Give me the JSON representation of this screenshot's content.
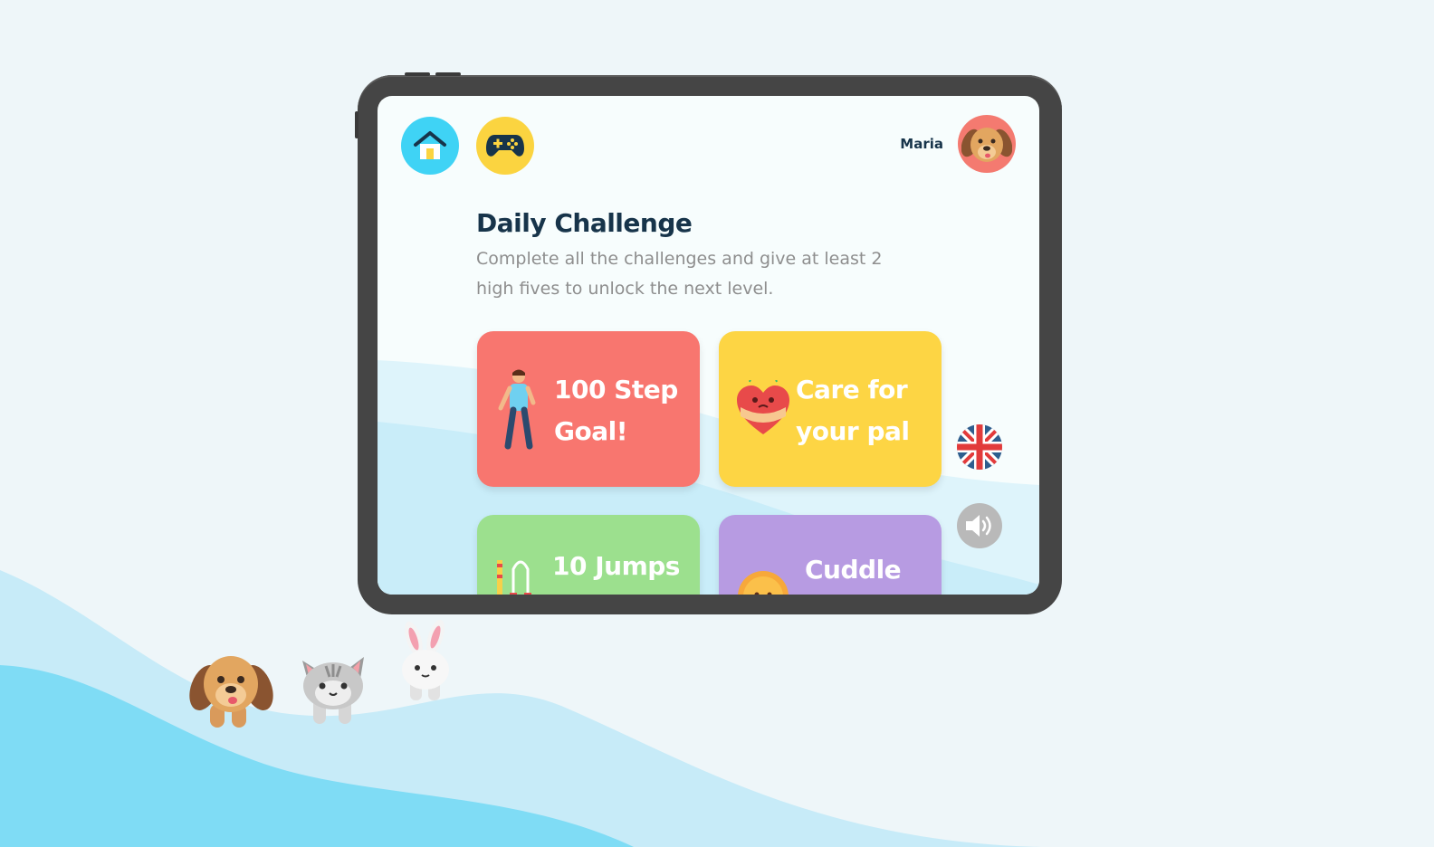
{
  "header": {
    "home_icon": "house-icon",
    "games_icon": "gamepad-icon",
    "username": "Maria",
    "avatar_icon": "dog-avatar-icon"
  },
  "challenge": {
    "title": "Daily Challenge",
    "description": "Complete all the challenges and give at least 2 high fives to unlock the next level."
  },
  "cards": [
    {
      "label": "100 Step Goal!",
      "icon": "walking-person-icon",
      "color": "#f8766f"
    },
    {
      "label": "Care for your pal",
      "icon": "hugging-heart-icon",
      "color": "#fdd544"
    },
    {
      "label": "10 Jumps",
      "icon": "jump-rope-icon",
      "color": "#9ce08e"
    },
    {
      "label": "Cuddle",
      "icon": "cuddle-face-icon",
      "color": "#b79be2"
    }
  ],
  "side_controls": {
    "language_icon": "uk-flag-icon",
    "sound_icon": "speaker-icon"
  },
  "colors": {
    "background": "#eef6f9",
    "title": "#17344a",
    "home_button": "#3fd3f5",
    "games_button": "#fbd440",
    "avatar_bg": "#f47a70"
  }
}
